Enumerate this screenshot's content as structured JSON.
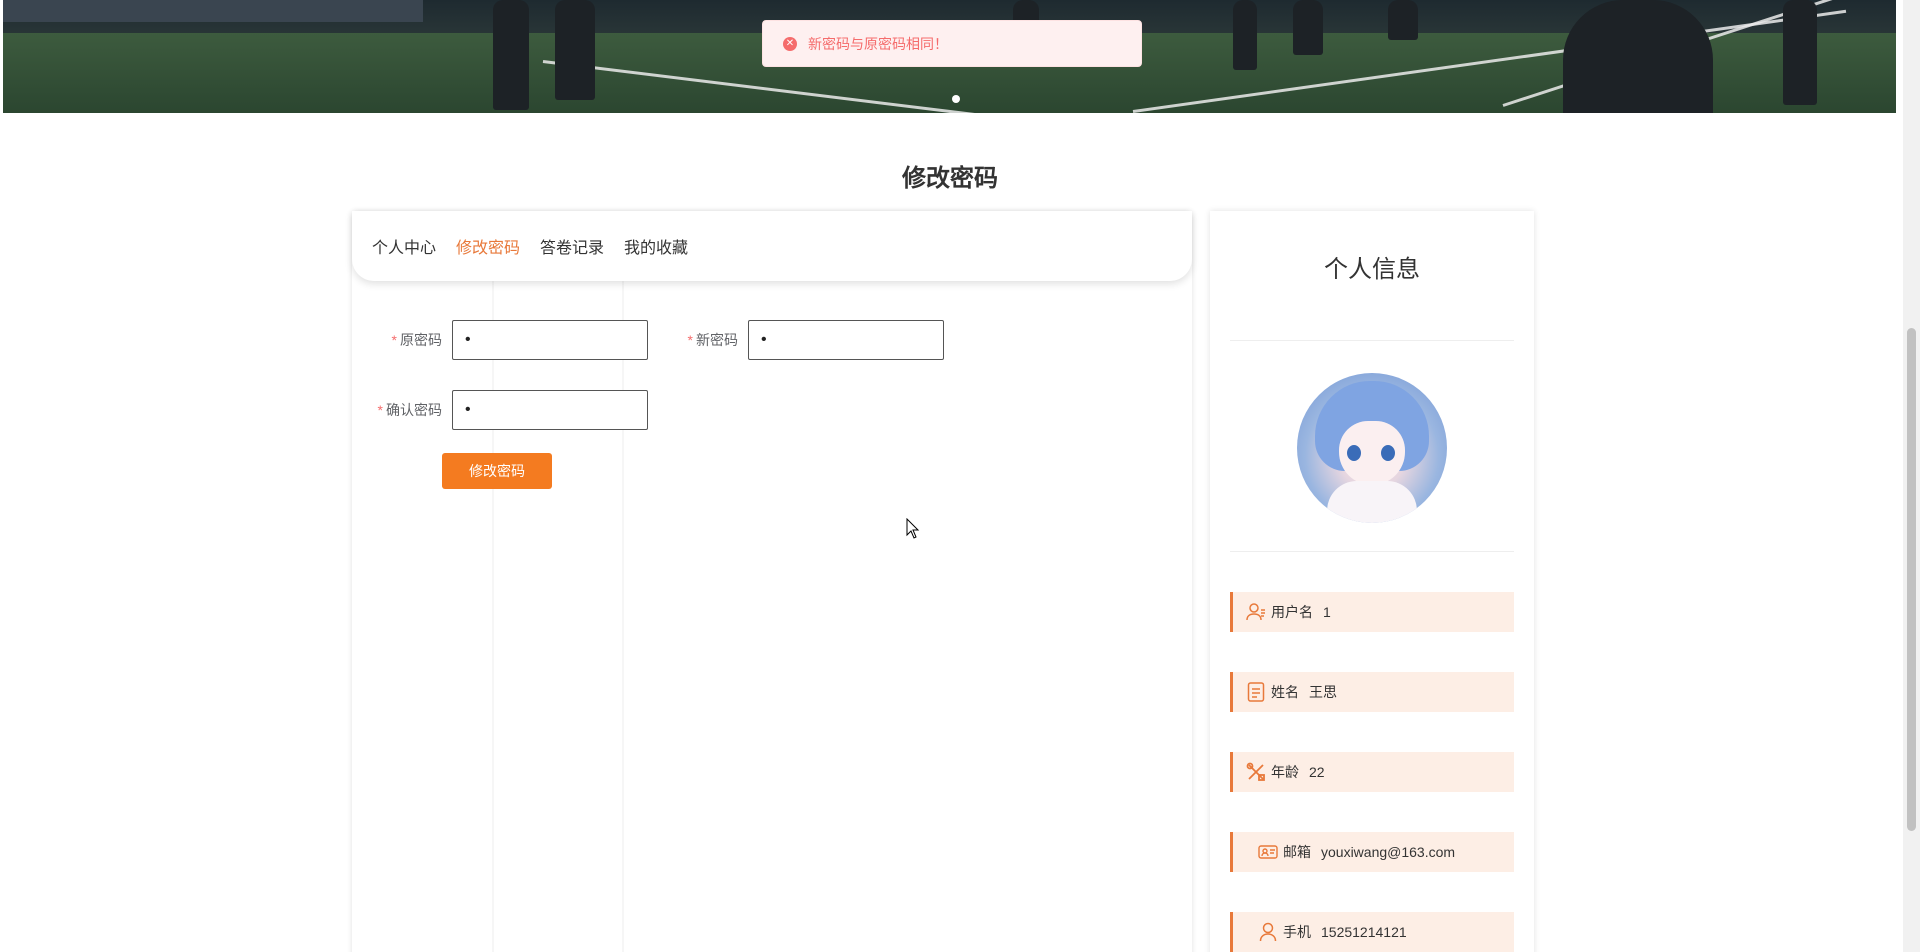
{
  "toast": {
    "message": "新密码与原密码相同！",
    "type": "error"
  },
  "page_title": "修改密码",
  "tabs": [
    {
      "label": "个人中心",
      "active": false
    },
    {
      "label": "修改密码",
      "active": true
    },
    {
      "label": "答卷记录",
      "active": false
    },
    {
      "label": "我的收藏",
      "active": false
    }
  ],
  "form": {
    "old_password": {
      "label": "原密码",
      "value": "•",
      "required": true
    },
    "new_password": {
      "label": "新密码",
      "value": "•",
      "required": true
    },
    "confirm_password": {
      "label": "确认密码",
      "value": "•",
      "required": true
    },
    "submit_label": "修改密码"
  },
  "profile": {
    "title": "个人信息",
    "items": [
      {
        "icon": "user-icon",
        "key": "用户名",
        "value": "1"
      },
      {
        "icon": "document-icon",
        "key": "姓名",
        "value": "王思"
      },
      {
        "icon": "tools-icon",
        "key": "年龄",
        "value": "22"
      },
      {
        "icon": "id-card-icon",
        "key": "邮箱",
        "value": "youxiwang@163.com"
      },
      {
        "icon": "person-icon",
        "key": "手机",
        "value": "15251214121"
      }
    ]
  },
  "colors": {
    "accent": "#e8793a",
    "button": "#f47b20",
    "error": "#f56c6c"
  }
}
